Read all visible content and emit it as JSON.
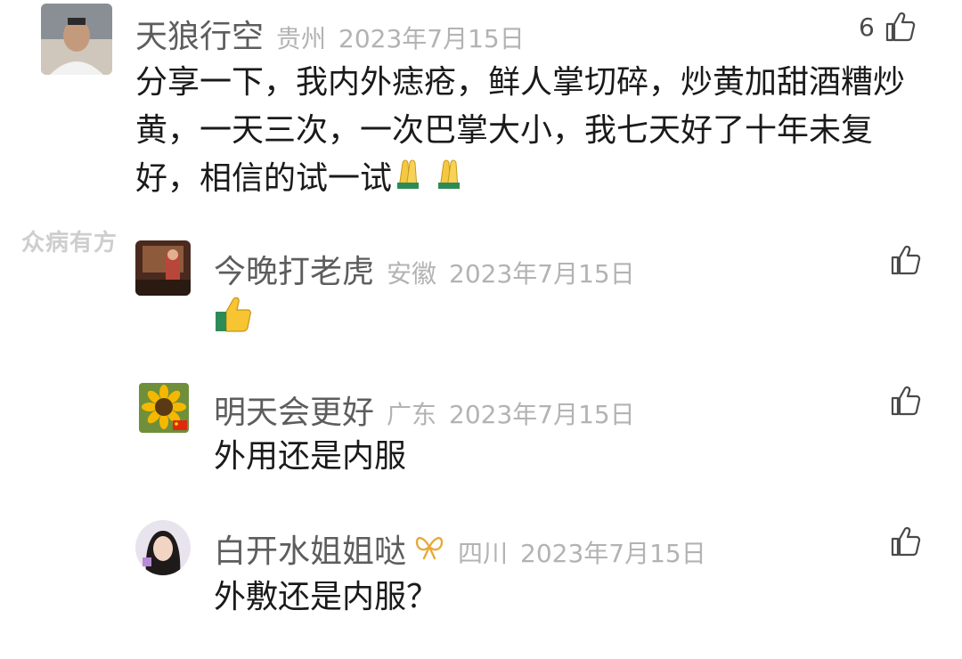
{
  "watermark": "众病有方",
  "comments": [
    {
      "username": "天狼行空",
      "location": "贵州",
      "date": "2023年7月15日",
      "like_count": "6",
      "text": "分享一下，我内外痣疮，鲜人掌切碎，炒黄加甜酒糟炒黄，一天三次，一次巴掌大小，我七天好了十年未复好，相信的试一试",
      "emoji": "pray-hands-icon"
    },
    {
      "username": "今晚打老虎",
      "location": "安徽",
      "date": "2023年7月15日",
      "like_count": "",
      "emoji": "thumbs-up-emoji"
    },
    {
      "username": "明天会更好",
      "location": "广东",
      "date": "2023年7月15日",
      "like_count": "",
      "text": "外用还是内服"
    },
    {
      "username": "白开水姐姐哒",
      "location": "四川",
      "date": "2023年7月15日",
      "like_count": "",
      "text": "外敷还是内服？",
      "badge": "ribbon-badge-icon"
    }
  ],
  "colors": {
    "username": "#5d5d5d",
    "meta": "#b3b3b3",
    "text": "#1a1a1a",
    "like": "#4a4a4a"
  }
}
